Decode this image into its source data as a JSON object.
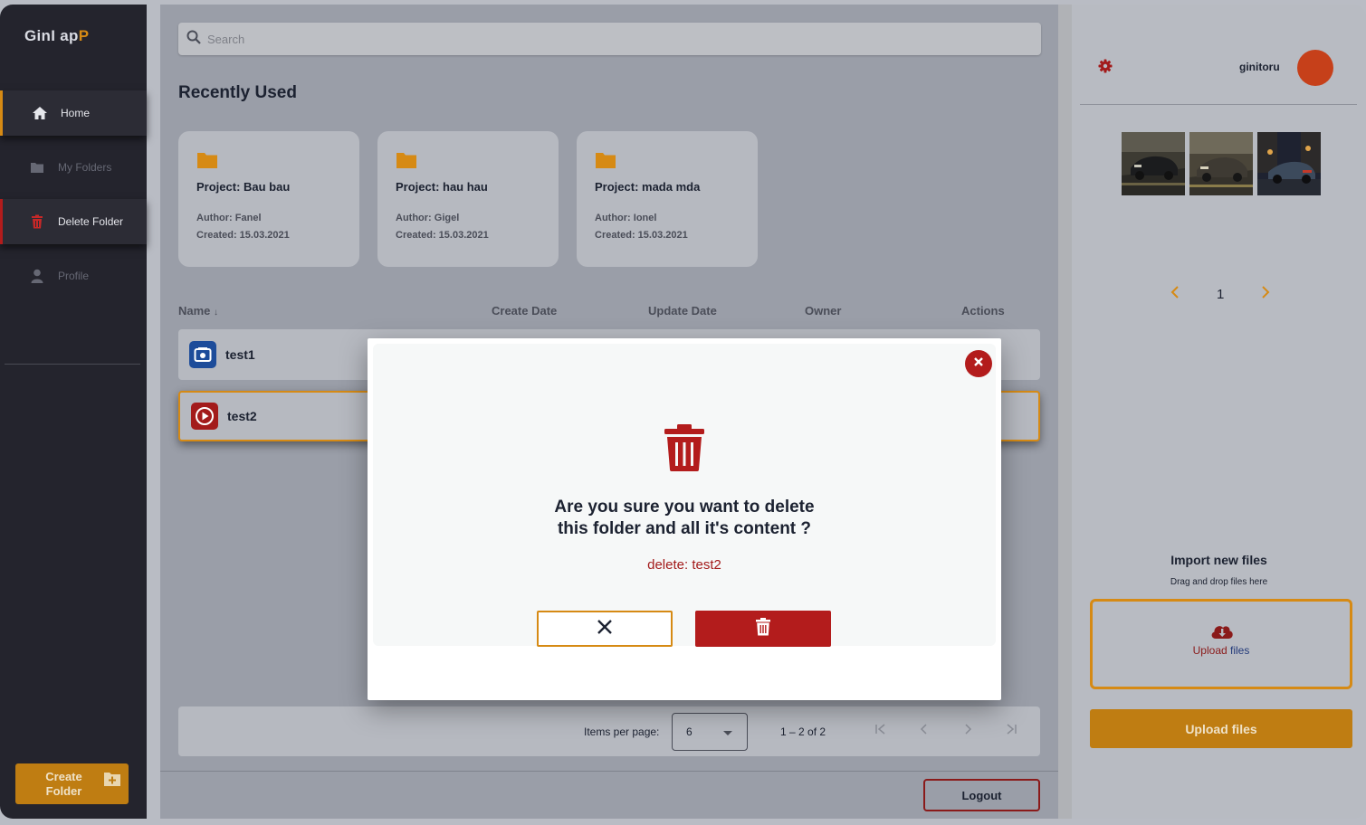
{
  "app": {
    "logo_part1": "GinI ap",
    "logo_part2": "P"
  },
  "sidebar": {
    "items": [
      {
        "label": "Home"
      },
      {
        "label": "My Folders"
      },
      {
        "label": "Delete Folder"
      },
      {
        "label": "Profile"
      }
    ],
    "create_folder_label": "Create Folder"
  },
  "search": {
    "placeholder": "Search"
  },
  "recent": {
    "title": "Recently Used",
    "cards": [
      {
        "title": "Project: Bau bau",
        "author": "Author: Fanel",
        "created": "Created: 15.03.2021"
      },
      {
        "title": "Project: hau hau",
        "author": "Author: Gigel",
        "created": "Created: 15.03.2021"
      },
      {
        "title": "Project: mada mda",
        "author": "Author: Ionel",
        "created": "Created: 15.03.2021"
      }
    ]
  },
  "table": {
    "headers": {
      "name": "Name",
      "sort_arrow": "↓",
      "create_date": "Create Date",
      "update_date": "Update Date",
      "owner": "Owner",
      "actions": "Actions"
    },
    "rows": [
      {
        "name": "test1",
        "icon": "camera-icon",
        "color": "#1d4c9a"
      },
      {
        "name": "test2",
        "icon": "play-icon",
        "color": "#a31b1b"
      }
    ]
  },
  "pager": {
    "items_per_page_label": "Items per page:",
    "items_per_page_value": "6",
    "range": "1 – 2 of 2"
  },
  "footer": {
    "logout_label": "Logout"
  },
  "user": {
    "name": "ginitoru",
    "avatar_color": "#c6401a"
  },
  "gallery": {
    "page": "1"
  },
  "import": {
    "title": "Import new files",
    "subtitle": "Drag and drop files here",
    "dropzone_label_1": "Upload",
    "dropzone_label_2": " files",
    "button_label": "Upload files"
  },
  "modal": {
    "question_line1": "Are you sure you want to delete",
    "question_line2": "this folder and all it's content ?",
    "target": "delete: test2"
  },
  "colors": {
    "accent": "#d68a14",
    "danger": "#b31c1c",
    "sidebar_bg": "#24242d"
  }
}
